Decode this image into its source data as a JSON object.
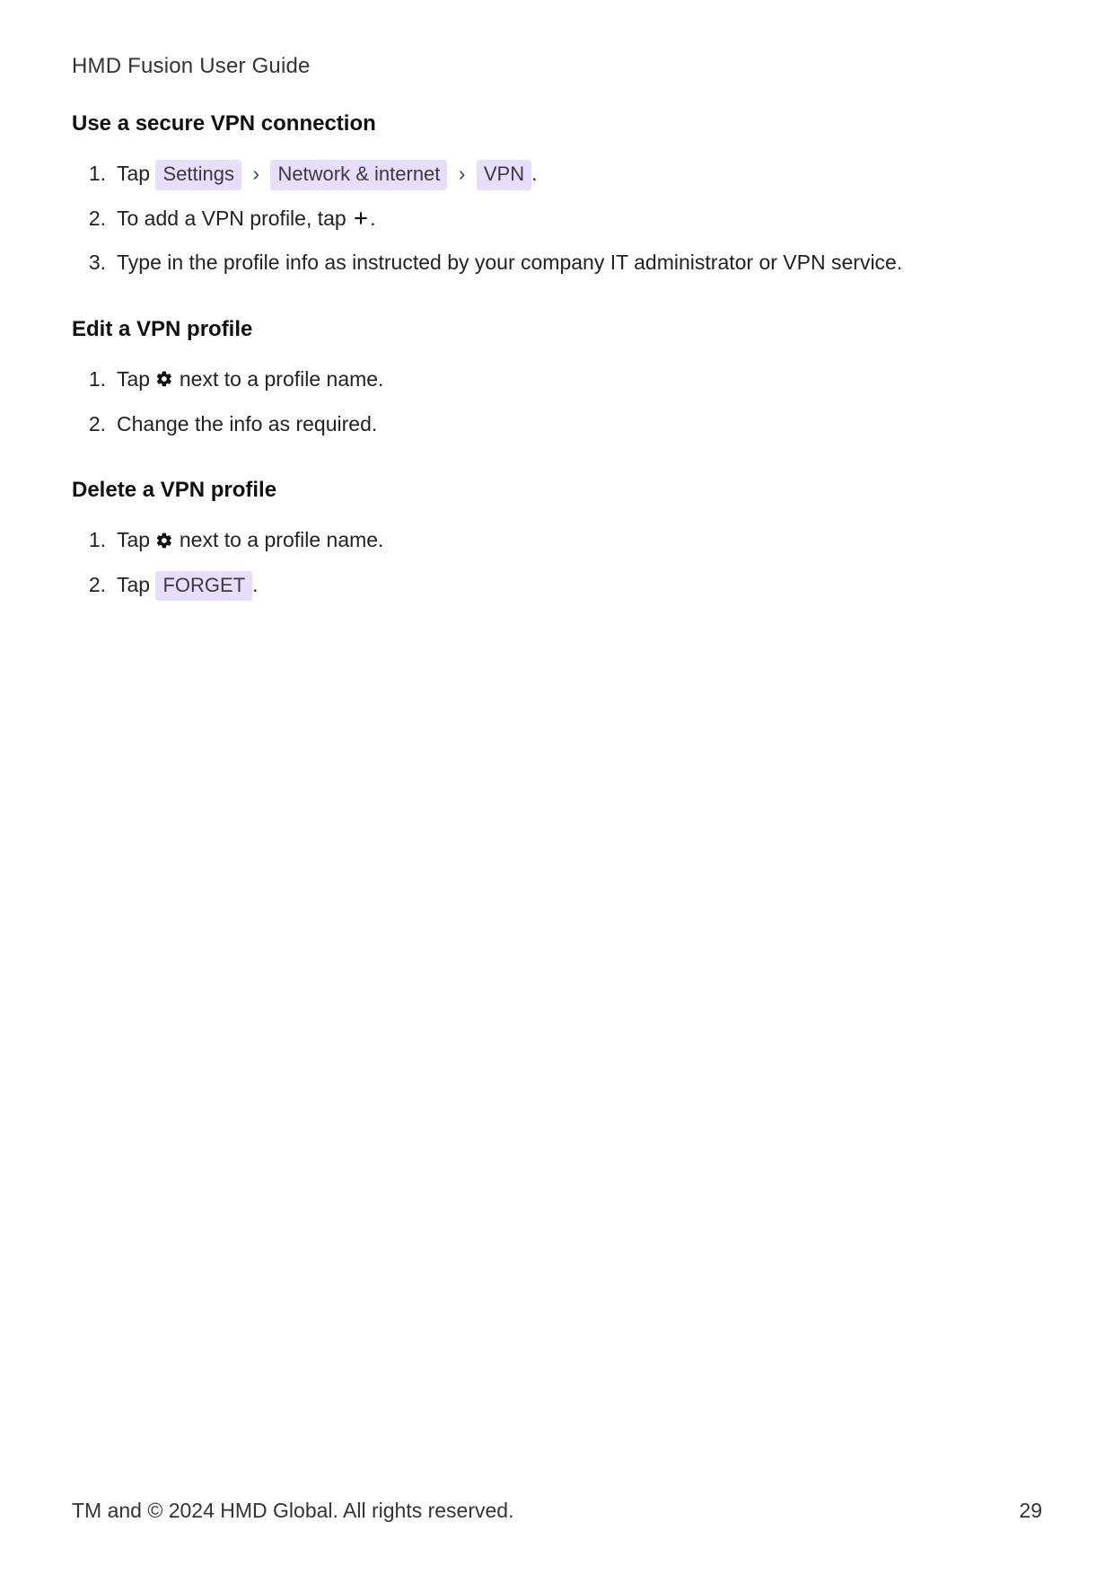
{
  "doc_title": "HMD Fusion User Guide",
  "sections": {
    "use_vpn": {
      "heading": "Use a secure VPN connection",
      "step1_prefix": "Tap ",
      "step1_chip1": "Settings",
      "step1_sep": "›",
      "step1_chip2": "Network & internet",
      "step1_chip3": "VPN",
      "step1_suffix": ".",
      "step2_prefix": "To add a VPN profile, tap ",
      "step2_suffix": ".",
      "step3": "Type in the profile info as instructed by your company IT administrator or VPN service."
    },
    "edit_vpn": {
      "heading": "Edit a VPN profile",
      "step1_prefix": "Tap ",
      "step1_suffix": " next to a profile name.",
      "step2": "Change the info as required."
    },
    "delete_vpn": {
      "heading": "Delete a VPN profile",
      "step1_prefix": "Tap ",
      "step1_suffix": " next to a profile name.",
      "step2_prefix": "Tap ",
      "step2_chip": "FORGET",
      "step2_suffix": "."
    }
  },
  "list": {
    "n1": "1.",
    "n2": "2.",
    "n3": "3."
  },
  "footer": {
    "copyright": "TM and © 2024 HMD Global.  All rights reserved.",
    "page_number": "29"
  },
  "icons": {
    "gear": "gear-icon",
    "plus": "plus-icon"
  }
}
